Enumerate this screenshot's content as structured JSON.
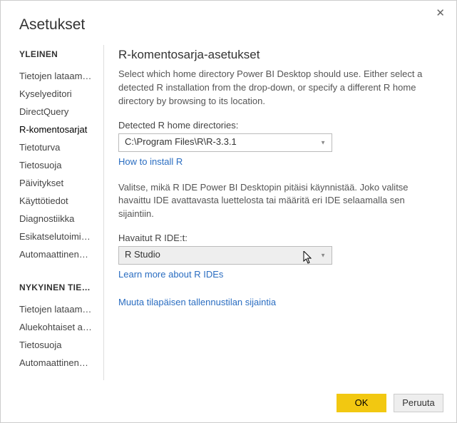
{
  "dialog": {
    "title": "Asetukset",
    "close": "✕"
  },
  "sidebar": {
    "section1_header": "YLEINEN",
    "section1_items": [
      "Tietojen lataam…",
      "Kyselyeditori",
      "DirectQuery",
      "R-komentosarjat",
      "Tietoturva",
      "Tietosuoja",
      "Päivitykset",
      "Käyttötiedot",
      "Diagnostiikka",
      "Esikatselutoimi…",
      "Automaattinen…"
    ],
    "section1_selected_index": 3,
    "section2_header": "NYKYINEN TIE…",
    "section2_items": [
      "Tietojen lataam…",
      "Aluekohtaiset a…",
      "Tietosuoja",
      "Automaattinen…"
    ]
  },
  "main": {
    "heading": "R-komentosarja-asetukset",
    "desc1": "Select which home directory Power BI Desktop should use. Either select a detected R installation from the drop-down, or specify a different R home directory by browsing to its location.",
    "label_detected": "Detected R home directories:",
    "detected_value": "C:\\Program Files\\R\\R-3.3.1",
    "link_install": "How to install R",
    "desc2": "Valitse, mikä R IDE Power BI Desktopin pitäisi käynnistää. Joko valitse havaittu IDE avattavasta luettelosta tai määritä eri IDE selaamalla sen sijaintiin.",
    "label_ide": "Havaitut R IDE:t:",
    "ide_value": "R Studio",
    "link_ide": "Learn more about R IDEs",
    "link_storage": "Muuta tilapäisen tallennustilan sijaintia"
  },
  "footer": {
    "ok": "OK",
    "cancel": "Peruuta"
  }
}
